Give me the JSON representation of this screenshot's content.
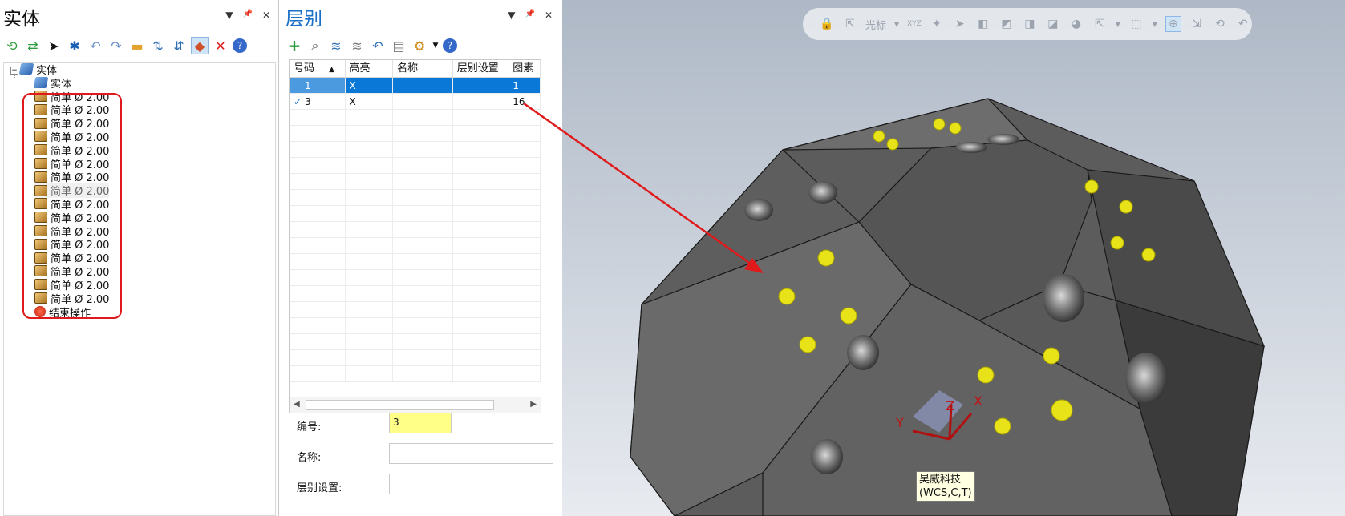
{
  "solids_panel": {
    "title": "实体",
    "ctrl_dropdown": "▼",
    "ctrl_pin": "📌",
    "ctrl_close": "✕",
    "tree": {
      "root_label": "实体",
      "solid_label": "实体",
      "operations": [
        "简单 Ø 2.00",
        "简单 Ø 2.00",
        "简单 Ø 2.00",
        "简单 Ø 2.00",
        "简单 Ø 2.00",
        "简单 Ø 2.00",
        "简单 Ø 2.00",
        "简单 Ø 2.00",
        "简单 Ø 2.00",
        "简单 Ø 2.00",
        "简单 Ø 2.00",
        "简单 Ø 2.00",
        "简单 Ø 2.00",
        "简单 Ø 2.00",
        "简单 Ø 2.00",
        "简单 Ø 2.00"
      ],
      "end_label": "结束操作"
    }
  },
  "levels_panel": {
    "title": "层别",
    "ctrl_dropdown": "▼",
    "ctrl_pin": "📌",
    "ctrl_close": "✕",
    "columns": [
      "号码",
      "高亮",
      "名称",
      "层别设置",
      "图素"
    ],
    "sort_arrow": "▲",
    "rows": [
      {
        "check": "",
        "number": "1",
        "highlight": "X",
        "name": "",
        "set": "",
        "entities": "1"
      },
      {
        "check": "✓",
        "number": "3",
        "highlight": "X",
        "name": "",
        "set": "",
        "entities": "16"
      }
    ],
    "scroll_left": "◀",
    "scroll_right": "▶",
    "form": {
      "number_label": "编号:",
      "number_value": "3",
      "name_label": "名称:",
      "name_value": "",
      "set_label": "层别设置:",
      "set_value": ""
    }
  },
  "viewport": {
    "toolbar_cursor_label": "光标",
    "toolbar_xyz_label": "XYZ",
    "axis_x": "X",
    "axis_y": "Y",
    "axis_z": "Z",
    "tooltip_line1": "昊威科技",
    "tooltip_line2": "(WCS,C,T)"
  },
  "colors": {
    "accent": "#1a6fc9",
    "selection": "#0a78d7",
    "highlight_box": "#e01a1a",
    "yellow_input": "#ffff88",
    "part_body": "#5a5a5a"
  }
}
